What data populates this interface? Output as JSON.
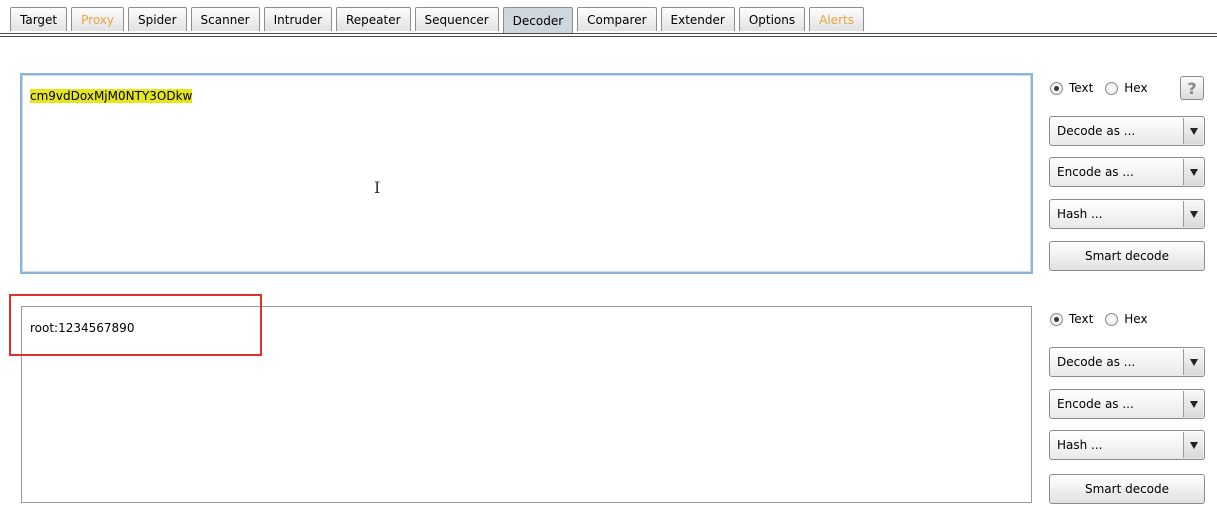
{
  "tabs": [
    {
      "label": "Target"
    },
    {
      "label": "Proxy"
    },
    {
      "label": "Spider"
    },
    {
      "label": "Scanner"
    },
    {
      "label": "Intruder"
    },
    {
      "label": "Repeater"
    },
    {
      "label": "Sequencer"
    },
    {
      "label": "Decoder"
    },
    {
      "label": "Comparer"
    },
    {
      "label": "Extender"
    },
    {
      "label": "Options"
    },
    {
      "label": "Alerts"
    }
  ],
  "active_tab": "Decoder",
  "colors": {
    "alert_tab": "#e8a33c",
    "highlight": "#e6e61e",
    "annotation": "#e0302c"
  },
  "input_pane": {
    "text": "cm9vdDoxMjM0NTY3ODkw",
    "mode_text": "Text",
    "mode_hex": "Hex",
    "selected_mode": "Text",
    "help_label": "?",
    "decode_as": "Decode as ...",
    "encode_as": "Encode as ...",
    "hash": "Hash ...",
    "smart_decode": "Smart decode"
  },
  "output_pane": {
    "text": "root:1234567890",
    "mode_text": "Text",
    "mode_hex": "Hex",
    "selected_mode": "Text",
    "decode_as": "Decode as ...",
    "encode_as": "Encode as ...",
    "hash": "Hash ...",
    "smart_decode": "Smart decode"
  }
}
